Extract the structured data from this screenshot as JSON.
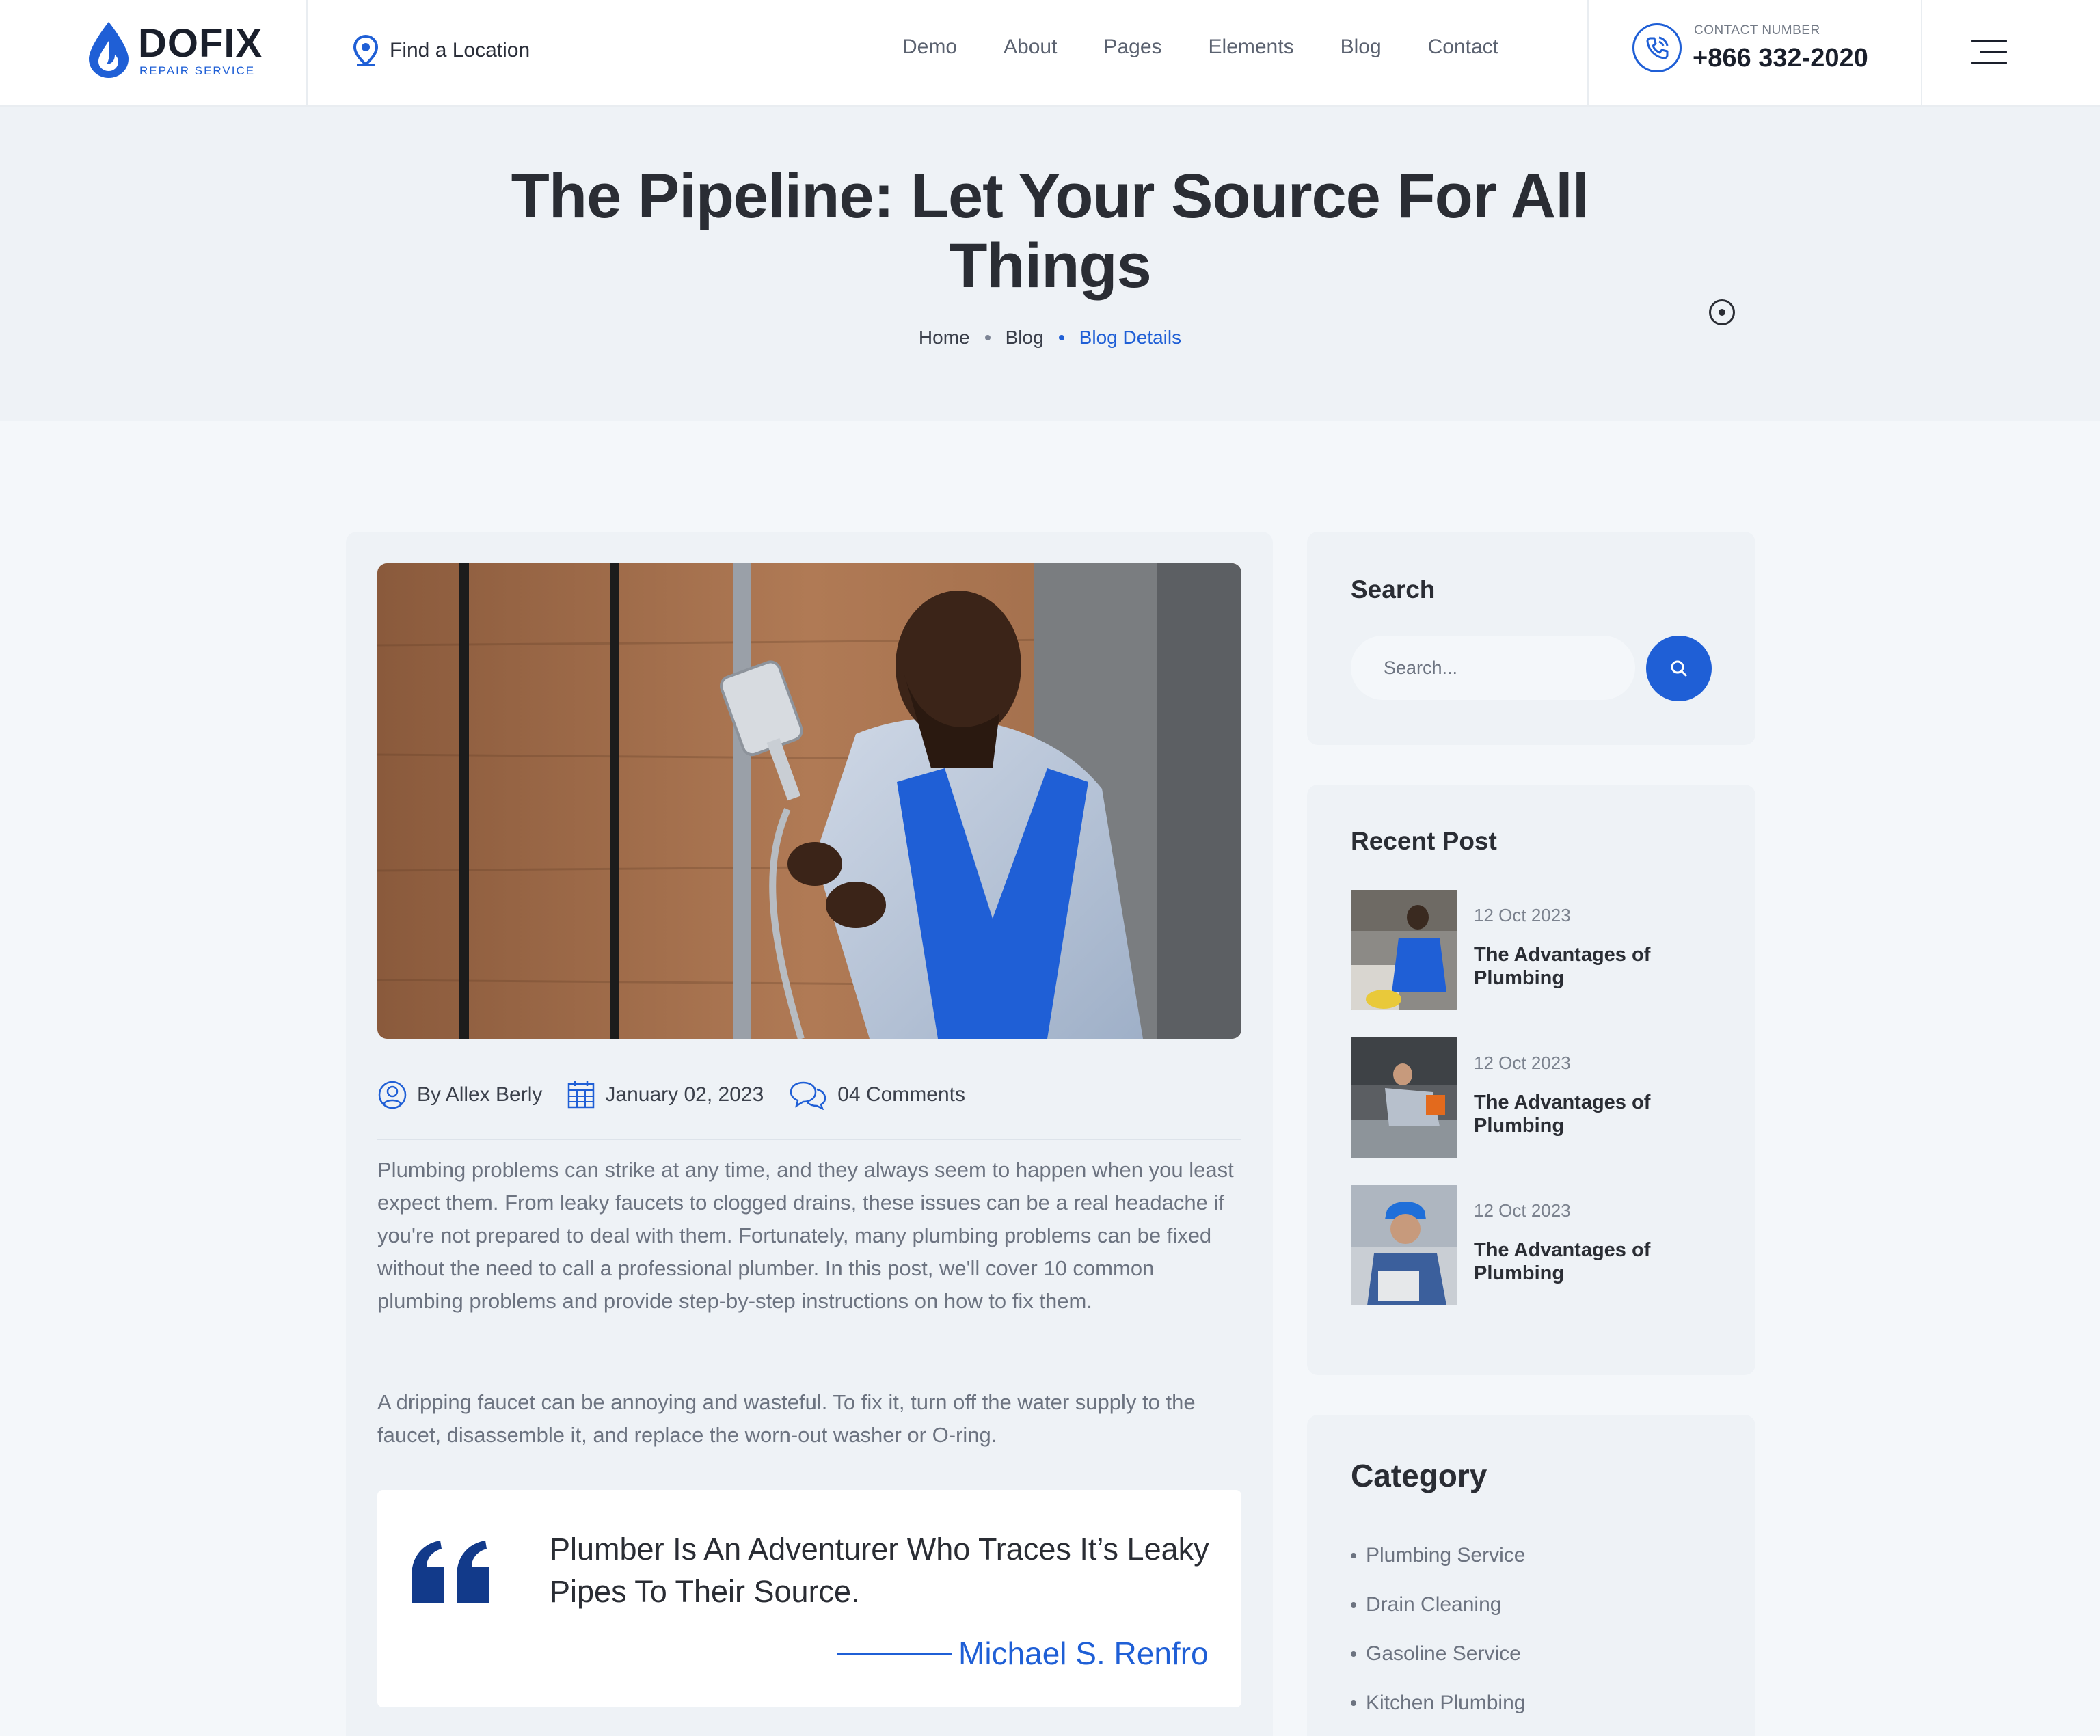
{
  "brand": {
    "name": "DOFIX",
    "tagline": "REPAIR SERVICE",
    "accent_color": "#1f5fd6"
  },
  "header": {
    "location_label": "Find a Location",
    "nav": [
      "Demo",
      "About",
      "Pages",
      "Elements",
      "Blog",
      "Contact"
    ],
    "contact_label": "CONTACT NUMBER",
    "contact_number": "+866 332-2020",
    "icons": {
      "location": "map-pin-icon",
      "phone": "phone-icon",
      "menu": "hamburger-menu-icon"
    }
  },
  "hero": {
    "title_line1": "The Pipeline: Let Your Source For All",
    "title_line2": "Things",
    "breadcrumb": [
      "Home",
      "Blog",
      "Blog Details"
    ]
  },
  "article": {
    "author": "By Allex Berly",
    "date": "January 02, 2023",
    "comments": "04 Comments",
    "paragraph1": "Plumbing problems can strike at any time, and they always seem to happen when you least expect them. From leaky faucets to clogged drains, these issues can be a real headache if you're not prepared to deal with them. Fortunately, many plumbing problems can be fixed without the need to call a professional plumber. In this post, we'll cover 10 common plumbing problems and provide step-by-step instructions on how to fix them.",
    "paragraph2": "A dripping faucet can be annoying and wasteful. To fix it, turn off the water supply to the faucet, disassemble it, and replace the worn-out washer or O-ring.",
    "quote": "Plumber Is An Adventurer Who Traces It’s Leaky Pipes To Their Source.",
    "quote_author": "Michael S. Renfro"
  },
  "sidebar": {
    "search": {
      "title": "Search",
      "placeholder": "Search..."
    },
    "recent": {
      "title": "Recent Post",
      "posts": [
        {
          "date": "12 Oct 2023",
          "title": "The Advantages of Plumbing"
        },
        {
          "date": "12 Oct 2023",
          "title": "The Advantages of Plumbing"
        },
        {
          "date": "12 Oct 2023",
          "title": "The Advantages of Plumbing"
        }
      ]
    },
    "category": {
      "title": "Category",
      "items": [
        "Plumbing Service",
        "Drain Cleaning",
        "Gasoline Service",
        "Kitchen Plumbing"
      ]
    }
  }
}
